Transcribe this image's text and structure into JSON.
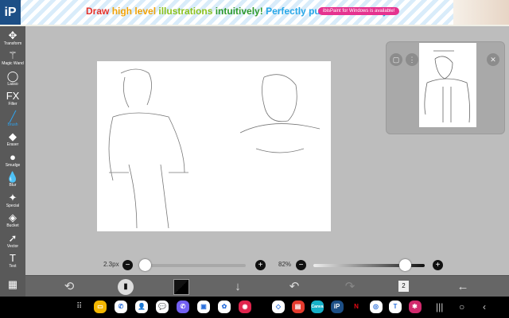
{
  "banner": {
    "logo": "iP",
    "tagline": [
      {
        "t": "Draw ",
        "c": "#e4322b"
      },
      {
        "t": "high level ",
        "c": "#f0a30a"
      },
      {
        "t": "illustrations ",
        "c": "#8cc21f"
      },
      {
        "t": "intuitively! ",
        "c": "#2f9a2c"
      },
      {
        "t": "Perfectly pursued usability!",
        "c": "#27a7e8"
      }
    ],
    "windows_badge": "ibisPaint for Windows is available!"
  },
  "tools": [
    {
      "label": "Transform",
      "icon": "✥"
    },
    {
      "label": "Magic Wand",
      "icon": "⚚"
    },
    {
      "label": "Lasso",
      "icon": "◯"
    },
    {
      "label": "Filter",
      "icon": "FX"
    },
    {
      "label": "Brush",
      "icon": "╱",
      "active": true
    },
    {
      "label": "Eraser",
      "icon": "◆"
    },
    {
      "label": "Smudge",
      "icon": "●"
    },
    {
      "label": "Blur",
      "icon": "💧"
    },
    {
      "label": "Special",
      "icon": "✦"
    },
    {
      "label": "Bucket",
      "icon": "◈"
    },
    {
      "label": "Vector",
      "icon": "➚"
    },
    {
      "label": "Text",
      "icon": "T"
    },
    {
      "label": "",
      "icon": "▦"
    }
  ],
  "sliders": {
    "brush_size": "2.3px",
    "opacity": "82%",
    "brush_size_fraction": 0.02,
    "opacity_fraction": 0.82
  },
  "toolbar": {
    "layer_count": "2"
  },
  "colors": {
    "accent": "#2fa3ee",
    "sidebar": "#595959"
  },
  "apps": [
    {
      "name": "files",
      "c": "#f3b700",
      "g": "▭"
    },
    {
      "name": "phone",
      "c": "#fff",
      "g": "✆"
    },
    {
      "name": "contacts",
      "c": "#fff",
      "g": "👤"
    },
    {
      "name": "messages",
      "c": "#fff",
      "g": "💬"
    },
    {
      "name": "viber",
      "c": "#7360f2",
      "g": "✆"
    },
    {
      "name": "meet",
      "c": "#fff",
      "g": "▣"
    },
    {
      "name": "photos",
      "c": "#fff",
      "g": "✿"
    },
    {
      "name": "screen-recorder",
      "c": "#e0244d",
      "g": "◉"
    },
    {
      "name": "maps",
      "c": "#fff",
      "g": "◇"
    },
    {
      "name": "notes",
      "c": "#e63b2e",
      "g": "▤"
    },
    {
      "name": "canva",
      "c": "#16b0c8",
      "g": "Canva"
    },
    {
      "name": "ibispaint",
      "c": "#1d4f86",
      "g": "iP"
    },
    {
      "name": "netflix",
      "c": "#000",
      "g": "N"
    },
    {
      "name": "chrome",
      "c": "#fff",
      "g": "◎"
    },
    {
      "name": "teams",
      "c": "#fff",
      "g": "T"
    },
    {
      "name": "flower",
      "c": "#d22a6d",
      "g": "✱"
    }
  ]
}
